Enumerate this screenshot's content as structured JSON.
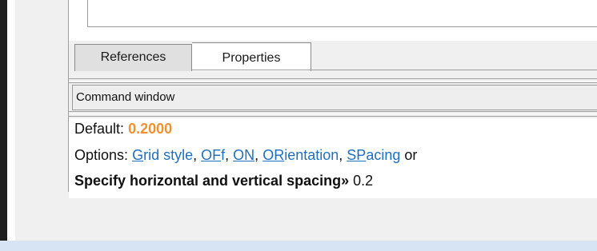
{
  "tabs": {
    "references": "References",
    "properties": "Properties"
  },
  "command_window": {
    "title": "Command window",
    "default_label": "Default:",
    "default_value": "0.2000",
    "options_label": "Options:",
    "options": [
      {
        "hotkey": "G",
        "rest": "rid style"
      },
      {
        "hotkey": "OF",
        "rest": "f"
      },
      {
        "hotkey": "ON",
        "rest": ""
      },
      {
        "hotkey": "OR",
        "rest": "ientation"
      },
      {
        "hotkey": "SP",
        "rest": "acing"
      }
    ],
    "separator": ",",
    "options_suffix": "or",
    "prompt": "Specify horizontal and vertical spacing»",
    "input_value": "0.2"
  },
  "colors": {
    "default_value": "#f0912f",
    "option_link": "#1f6fbf",
    "window_band": "#d6e4f4"
  }
}
